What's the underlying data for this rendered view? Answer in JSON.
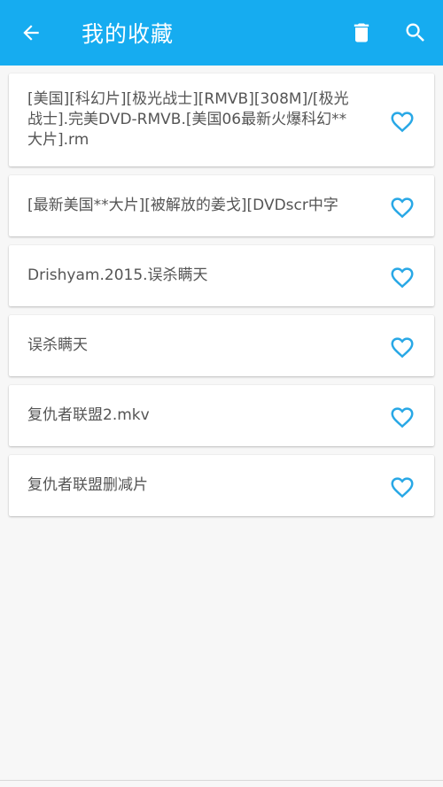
{
  "appbar": {
    "title": "我的收藏",
    "back_icon": "arrow-left-icon",
    "delete_icon": "trash-icon",
    "search_icon": "search-icon",
    "background_color": "#16acf0"
  },
  "favorites": {
    "heart_color": "#29a8e6",
    "items": [
      {
        "title": "[美国][科幻片][极光战士][RMVB][308M]/[极光战士].完美DVD-RMVB.[美国06最新火爆科幻**大片].rm"
      },
      {
        "title": "[最新美国**大片][被解放的姜戈][DVDscr中字"
      },
      {
        "title": "Drishyam.2015.误杀瞒天"
      },
      {
        "title": "误杀瞒天"
      },
      {
        "title": "复仇者联盟2.mkv"
      },
      {
        "title": "复仇者联盟删减片"
      }
    ]
  }
}
